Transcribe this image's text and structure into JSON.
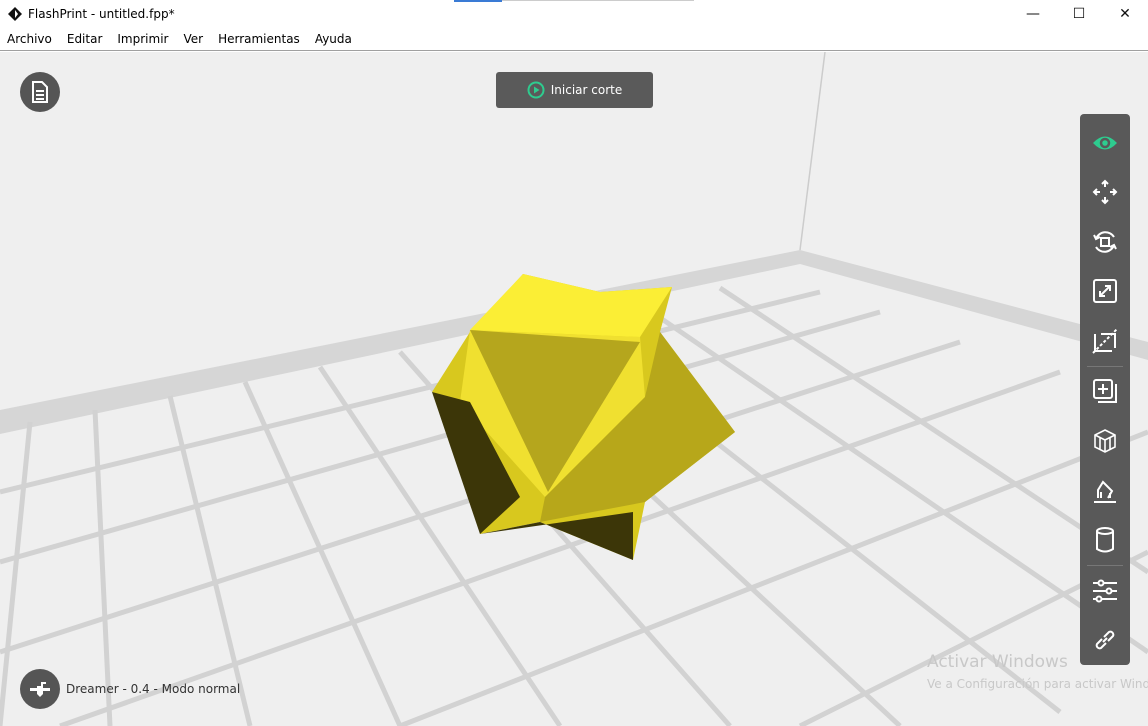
{
  "window": {
    "title": "FlashPrint - untitled.fpp*",
    "minimize": "—",
    "maximize": "☐",
    "close": "✕"
  },
  "menu": [
    "Archivo",
    "Editar",
    "Imprimir",
    "Ver",
    "Herramientas",
    "Ayuda"
  ],
  "slice_button": {
    "label": "Iniciar corte"
  },
  "toolbar": [
    "view",
    "move",
    "rotate",
    "scale",
    "cut",
    "add",
    "supports",
    "print-settings",
    "extruder",
    "settings",
    "link"
  ],
  "status": {
    "printer": "Dreamer - 0.4 - Modo normal"
  },
  "watermark": {
    "title": "Activar Windows",
    "subtitle": "Ve a Configuración para activar Windows."
  },
  "colors": {
    "accent": "#2ecc8f",
    "panel": "#595959",
    "model": "#f5e62a"
  }
}
